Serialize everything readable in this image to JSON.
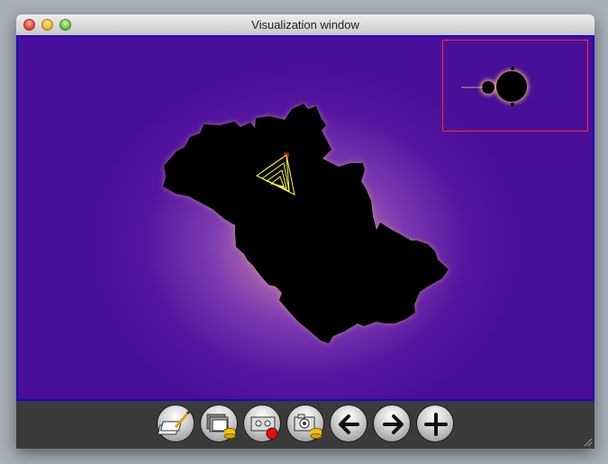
{
  "window": {
    "title": "Visualization window"
  },
  "toolbar": {
    "buttons": [
      {
        "icon": "edit-pages-icon"
      },
      {
        "icon": "save-images-icon"
      },
      {
        "icon": "record-video-icon"
      },
      {
        "icon": "save-snapshot-icon"
      },
      {
        "icon": "back-arrow-icon"
      },
      {
        "icon": "forward-arrow-icon"
      },
      {
        "icon": "zoom-plus-icon"
      }
    ]
  },
  "colors": {
    "background": "#4a0f98",
    "fractal": "#000000",
    "minimap_border": "#ff2a3a",
    "orbit": "#ffff00",
    "frame": "#1a0cbf"
  }
}
